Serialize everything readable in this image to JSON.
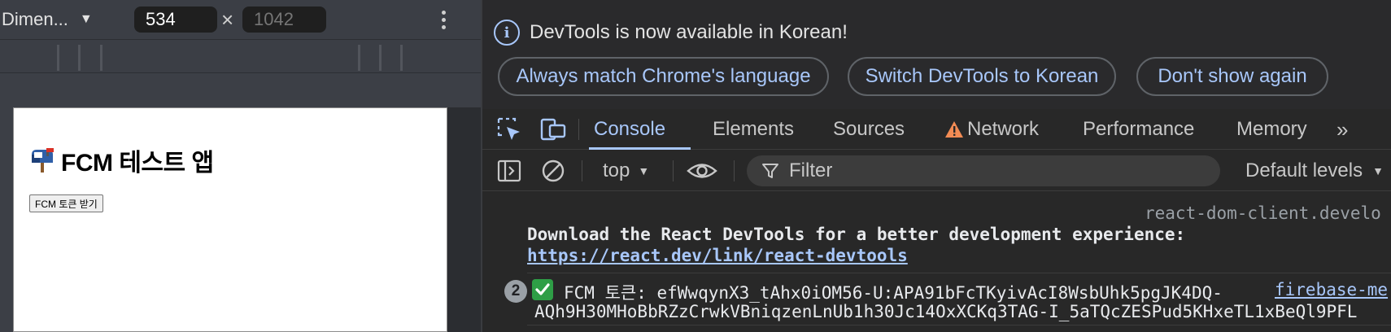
{
  "device_toolbar": {
    "dimensions_label": "Dimen...",
    "width_value": "534",
    "height_placeholder": "1042",
    "times_symbol": "×"
  },
  "page": {
    "title": "FCM 테스트 앱",
    "mailbox_icon": "open-mailbox-icon",
    "button_label": "FCM 토큰 받기"
  },
  "infobar": {
    "message": "DevTools is now available in Korean!",
    "buttons": [
      "Always match Chrome's language",
      "Switch DevTools to Korean",
      "Don't show again"
    ]
  },
  "tabs": {
    "items": [
      "Console",
      "Elements",
      "Sources",
      "Network",
      "Performance",
      "Memory"
    ],
    "active": "Console",
    "more": "»"
  },
  "console_toolbar": {
    "context": "top",
    "filter_placeholder": "Filter",
    "levels": "Default levels"
  },
  "console": {
    "messages": [
      {
        "source": "react-dom-client.develo",
        "text": "Download the React DevTools for a better development experience:",
        "link": "https://react.dev/link/react-devtools"
      },
      {
        "count": "2",
        "text": "FCM 토큰: efWwqynX3_tAhx0iOM56-U:APA91bFcTKyivAcI8WsbUhk5pgJK4DQ-",
        "text_cont": "AQh9H30MHoBbRZzCrwkVBniqzenLnUb1h30Jc14OxXCKq3TAG-I_5aTQcZESPud5KHxeTL1xBeQl9PFL",
        "source": "firebase-me"
      }
    ]
  },
  "colors": {
    "accent": "#a8c7fa",
    "devtools_bg": "#282828",
    "warning": "#f28b54",
    "success": "#2e9e46"
  }
}
